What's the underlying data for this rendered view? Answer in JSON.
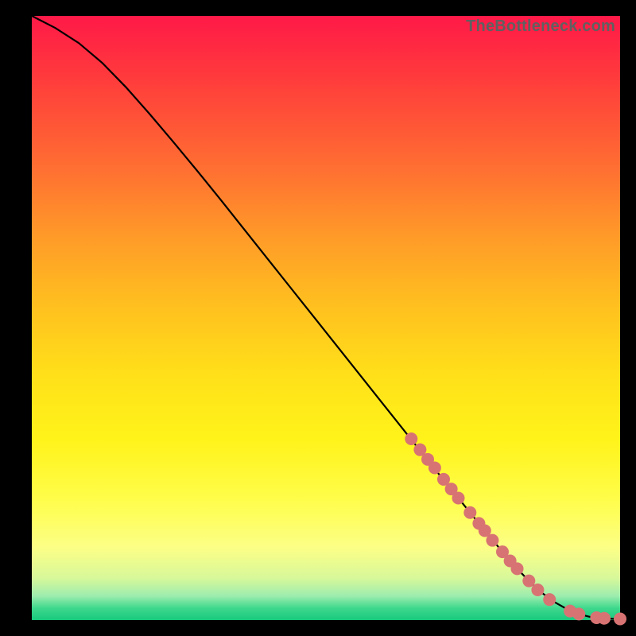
{
  "watermark": "TheBottleneck.com",
  "colors": {
    "marker": "#d87373",
    "line": "#000000",
    "gradient_top": "#ff1948",
    "gradient_bottom": "#17c97d"
  },
  "chart_data": {
    "type": "line",
    "title": "",
    "xlabel": "",
    "ylabel": "",
    "xlim": [
      0,
      100
    ],
    "ylim": [
      0,
      100
    ],
    "series": [
      {
        "name": "curve",
        "x": [
          0,
          4,
          8,
          12,
          16,
          20,
          24,
          28,
          32,
          36,
          40,
          44,
          48,
          52,
          56,
          60,
          64,
          68,
          72,
          76,
          80,
          83,
          85,
          87,
          89,
          91,
          93,
          95,
          97,
          99,
          100
        ],
        "y": [
          100,
          98,
          95.5,
          92.2,
          88.2,
          83.8,
          79.2,
          74.5,
          69.7,
          64.8,
          59.9,
          55.0,
          50.1,
          45.2,
          40.3,
          35.4,
          30.5,
          25.6,
          20.8,
          16.0,
          11.3,
          8.0,
          6.0,
          4.3,
          2.9,
          1.8,
          1.0,
          0.5,
          0.3,
          0.2,
          0.2
        ]
      }
    ],
    "markers": [
      {
        "x": 64.5,
        "y": 30.0
      },
      {
        "x": 66.0,
        "y": 28.2
      },
      {
        "x": 67.3,
        "y": 26.6
      },
      {
        "x": 68.5,
        "y": 25.2
      },
      {
        "x": 70.0,
        "y": 23.3
      },
      {
        "x": 71.3,
        "y": 21.7
      },
      {
        "x": 72.5,
        "y": 20.2
      },
      {
        "x": 74.5,
        "y": 17.8
      },
      {
        "x": 76.0,
        "y": 16.0
      },
      {
        "x": 77.0,
        "y": 14.8
      },
      {
        "x": 78.3,
        "y": 13.2
      },
      {
        "x": 80.0,
        "y": 11.3
      },
      {
        "x": 81.3,
        "y": 9.8
      },
      {
        "x": 82.5,
        "y": 8.5
      },
      {
        "x": 84.5,
        "y": 6.5
      },
      {
        "x": 86.0,
        "y": 5.0
      },
      {
        "x": 88.0,
        "y": 3.4
      },
      {
        "x": 91.5,
        "y": 1.5
      },
      {
        "x": 93.0,
        "y": 1.0
      },
      {
        "x": 96.0,
        "y": 0.4
      },
      {
        "x": 97.3,
        "y": 0.3
      },
      {
        "x": 100.0,
        "y": 0.2
      }
    ]
  }
}
